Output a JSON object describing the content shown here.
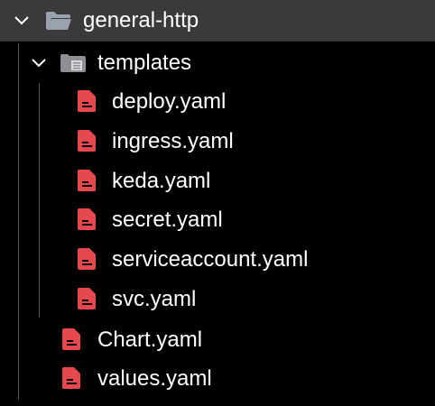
{
  "colors": {
    "background": "#000000",
    "header_background": "#3a3a3c",
    "text": "#ffffff",
    "folder_icon": "#9aa3ad",
    "file_icon": "#e5484d"
  },
  "tree": {
    "root": {
      "label": "general-http",
      "expanded": true,
      "icon": "folder-open-icon"
    },
    "templates": {
      "label": "templates",
      "expanded": true,
      "icon": "folder-open-icon"
    },
    "template_files": [
      {
        "label": "deploy.yaml",
        "icon": "yaml-file-icon"
      },
      {
        "label": "ingress.yaml",
        "icon": "yaml-file-icon"
      },
      {
        "label": "keda.yaml",
        "icon": "yaml-file-icon"
      },
      {
        "label": "secret.yaml",
        "icon": "yaml-file-icon"
      },
      {
        "label": "serviceaccount.yaml",
        "icon": "yaml-file-icon"
      },
      {
        "label": "svc.yaml",
        "icon": "yaml-file-icon"
      }
    ],
    "root_files": [
      {
        "label": "Chart.yaml",
        "icon": "yaml-file-icon"
      },
      {
        "label": "values.yaml",
        "icon": "yaml-file-icon"
      }
    ]
  }
}
